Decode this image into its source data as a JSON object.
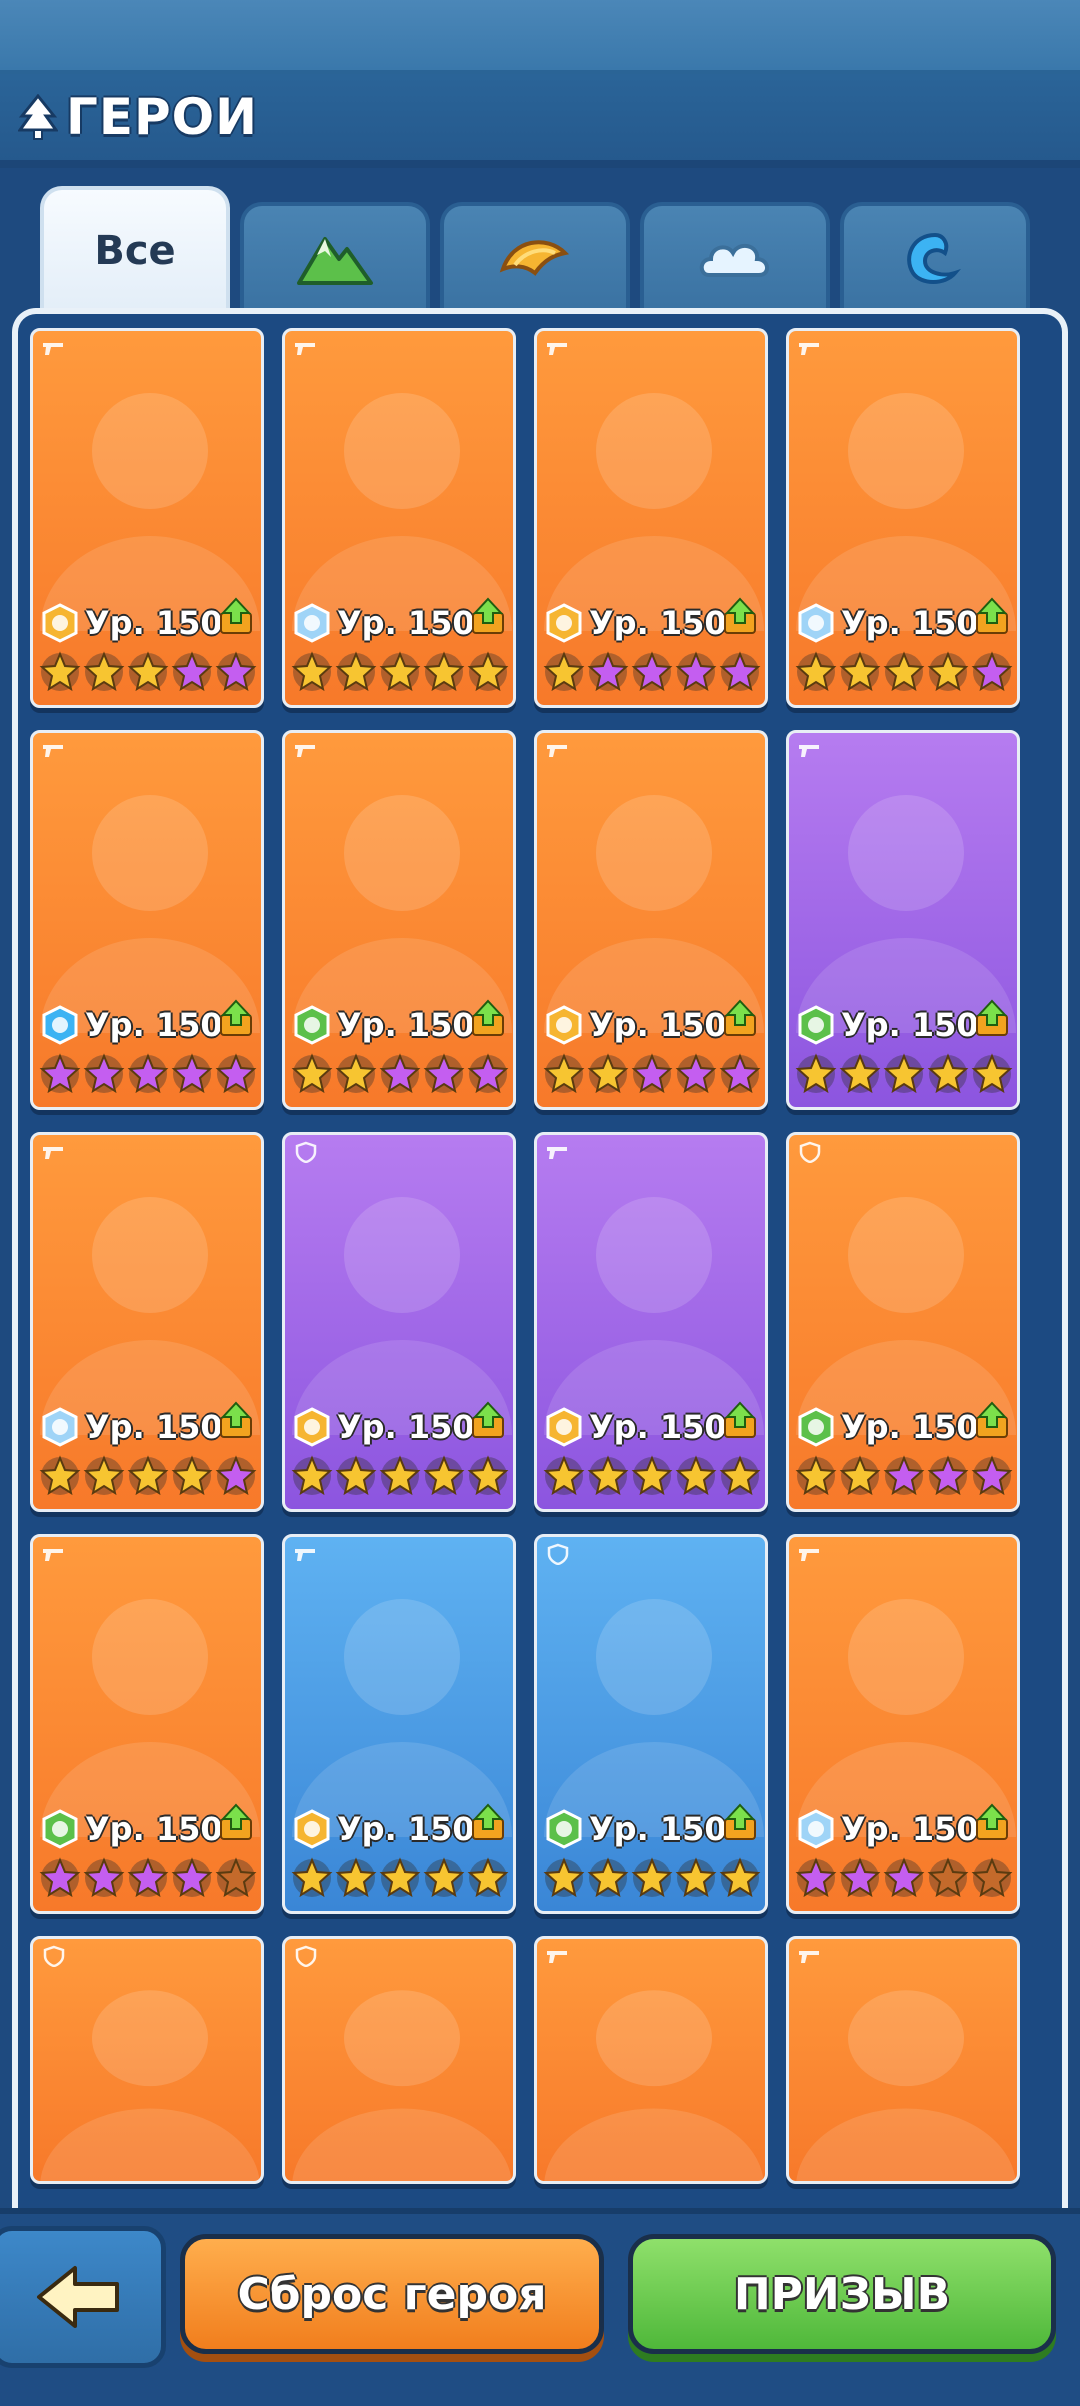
{
  "header": {
    "title": "ГЕРОИ",
    "title_icon": "tree-icon"
  },
  "tabs": [
    {
      "label": "Все",
      "icon": "",
      "active": true
    },
    {
      "label": "",
      "icon": "mountain-icon"
    },
    {
      "label": "",
      "icon": "sand-icon"
    },
    {
      "label": "",
      "icon": "cloud-icon"
    },
    {
      "label": "",
      "icon": "wave-icon"
    }
  ],
  "heroes": [
    {
      "level": "Ур. 150",
      "bg": "orange",
      "element": "sand",
      "class": "gun",
      "stars": [
        "gold",
        "gold",
        "gold",
        "purple",
        "purple"
      ]
    },
    {
      "level": "Ур. 150",
      "bg": "orange",
      "element": "cloud",
      "class": "gun",
      "stars": [
        "gold",
        "gold",
        "gold",
        "gold",
        "gold"
      ]
    },
    {
      "level": "Ур. 150",
      "bg": "orange",
      "element": "sand",
      "class": "gun",
      "stars": [
        "gold",
        "purple",
        "purple",
        "purple",
        "purple"
      ]
    },
    {
      "level": "Ур. 150",
      "bg": "orange",
      "element": "cloud",
      "class": "gun",
      "stars": [
        "gold",
        "gold",
        "gold",
        "gold",
        "purple"
      ]
    },
    {
      "level": "Ур. 150",
      "bg": "orange",
      "element": "wave",
      "class": "gun",
      "stars": [
        "purple",
        "purple",
        "purple",
        "purple",
        "purple"
      ]
    },
    {
      "level": "Ур. 150",
      "bg": "orange",
      "element": "mountain",
      "class": "gun",
      "stars": [
        "gold",
        "gold",
        "purple",
        "purple",
        "purple"
      ]
    },
    {
      "level": "Ур. 150",
      "bg": "orange",
      "element": "sand",
      "class": "gun",
      "stars": [
        "gold",
        "gold",
        "purple",
        "purple",
        "purple"
      ]
    },
    {
      "level": "Ур. 150",
      "bg": "purple",
      "element": "mountain",
      "class": "gun",
      "stars": [
        "gold",
        "gold",
        "gold",
        "gold",
        "gold"
      ]
    },
    {
      "level": "Ур. 150",
      "bg": "orange",
      "element": "cloud",
      "class": "gun",
      "stars": [
        "gold",
        "gold",
        "gold",
        "gold",
        "purple"
      ]
    },
    {
      "level": "Ур. 150",
      "bg": "purple",
      "element": "sand",
      "class": "shield",
      "stars": [
        "gold",
        "gold",
        "gold",
        "gold",
        "gold"
      ]
    },
    {
      "level": "Ур. 150",
      "bg": "purple",
      "element": "sand",
      "class": "gun",
      "stars": [
        "gold",
        "gold",
        "gold",
        "gold",
        "gold"
      ]
    },
    {
      "level": "Ур. 150",
      "bg": "orange",
      "element": "mountain",
      "class": "shield",
      "stars": [
        "gold",
        "gold",
        "purple",
        "purple",
        "purple"
      ]
    },
    {
      "level": "Ур. 150",
      "bg": "orange",
      "element": "mountain",
      "class": "gun",
      "stars": [
        "purple",
        "purple",
        "purple",
        "purple",
        "brown"
      ]
    },
    {
      "level": "Ур. 150",
      "bg": "blue",
      "element": "sand",
      "class": "gun",
      "stars": [
        "gold",
        "gold",
        "gold",
        "gold",
        "gold"
      ]
    },
    {
      "level": "Ур. 150",
      "bg": "blue",
      "element": "mountain",
      "class": "shield",
      "stars": [
        "gold",
        "gold",
        "gold",
        "gold",
        "gold"
      ]
    },
    {
      "level": "Ур. 150",
      "bg": "orange",
      "element": "cloud",
      "class": "gun",
      "stars": [
        "purple",
        "purple",
        "purple",
        "brown",
        "brown"
      ]
    }
  ],
  "partial_heroes": [
    {
      "bg": "orange",
      "class": "shield"
    },
    {
      "bg": "orange",
      "class": "shield"
    },
    {
      "bg": "orange",
      "class": "gun"
    },
    {
      "bg": "orange",
      "class": "gun"
    }
  ],
  "bottom": {
    "back_icon": "arrow-left-icon",
    "reset_label": "Сброс героя",
    "summon_label": "ПРИЗЫВ"
  },
  "colors": {
    "orange": "#f7862e",
    "purple": "#9f66e6",
    "blue": "#4a9be4",
    "star_gold": "#f7c531",
    "star_purple": "#c45ef0",
    "star_brown": "#c46a2b"
  }
}
